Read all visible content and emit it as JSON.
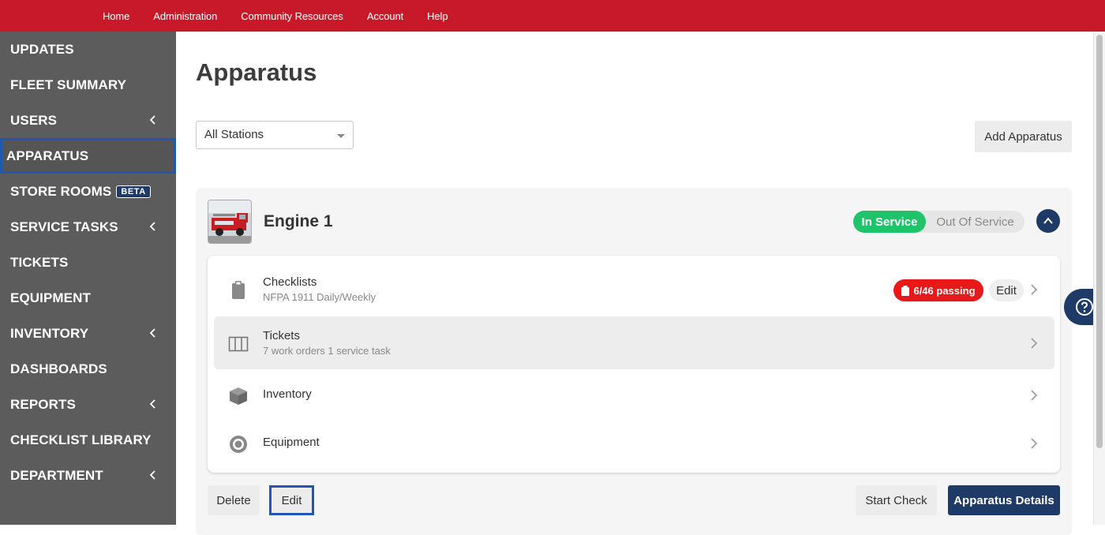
{
  "topnav": {
    "items": [
      "Home",
      "Administration",
      "Community Resources",
      "Account",
      "Help"
    ]
  },
  "sidebar": {
    "items": [
      {
        "label": "UPDATES"
      },
      {
        "label": "FLEET SUMMARY"
      },
      {
        "label": "USERS",
        "expandable": true
      },
      {
        "label": "APPARATUS",
        "active": true
      },
      {
        "label": "STORE ROOMS",
        "badge": "BETA"
      },
      {
        "label": "SERVICE TASKS",
        "expandable": true
      },
      {
        "label": "TICKETS"
      },
      {
        "label": "EQUIPMENT"
      },
      {
        "label": "INVENTORY",
        "expandable": true
      },
      {
        "label": "DASHBOARDS"
      },
      {
        "label": "REPORTS",
        "expandable": true
      },
      {
        "label": "CHECKLIST LIBRARY"
      },
      {
        "label": "DEPARTMENT",
        "expandable": true
      }
    ]
  },
  "main": {
    "title": "Apparatus",
    "station_filter": {
      "value": "All Stations"
    },
    "add_button": "Add Apparatus"
  },
  "apparatus": {
    "name": "Engine 1",
    "status_on": "In Service",
    "status_off": "Out Of Service",
    "rows": {
      "checklists": {
        "label": "Checklists",
        "sub": "NFPA 1911 Daily/Weekly",
        "badge": "6/46 passing",
        "edit": "Edit"
      },
      "tickets": {
        "label": "Tickets",
        "sub": "7 work orders 1 service task"
      },
      "inventory": {
        "label": "Inventory"
      },
      "equipment": {
        "label": "Equipment"
      }
    },
    "actions": {
      "delete": "Delete",
      "edit": "Edit",
      "start_check": "Start Check",
      "details": "Apparatus Details"
    }
  },
  "colors": {
    "topbar": "#c8192a",
    "sidebar": "#5c5c5c",
    "navy": "#1e3a66",
    "in_service": "#1fc36a",
    "failing": "#e7191a",
    "focus": "#1f57b5"
  }
}
